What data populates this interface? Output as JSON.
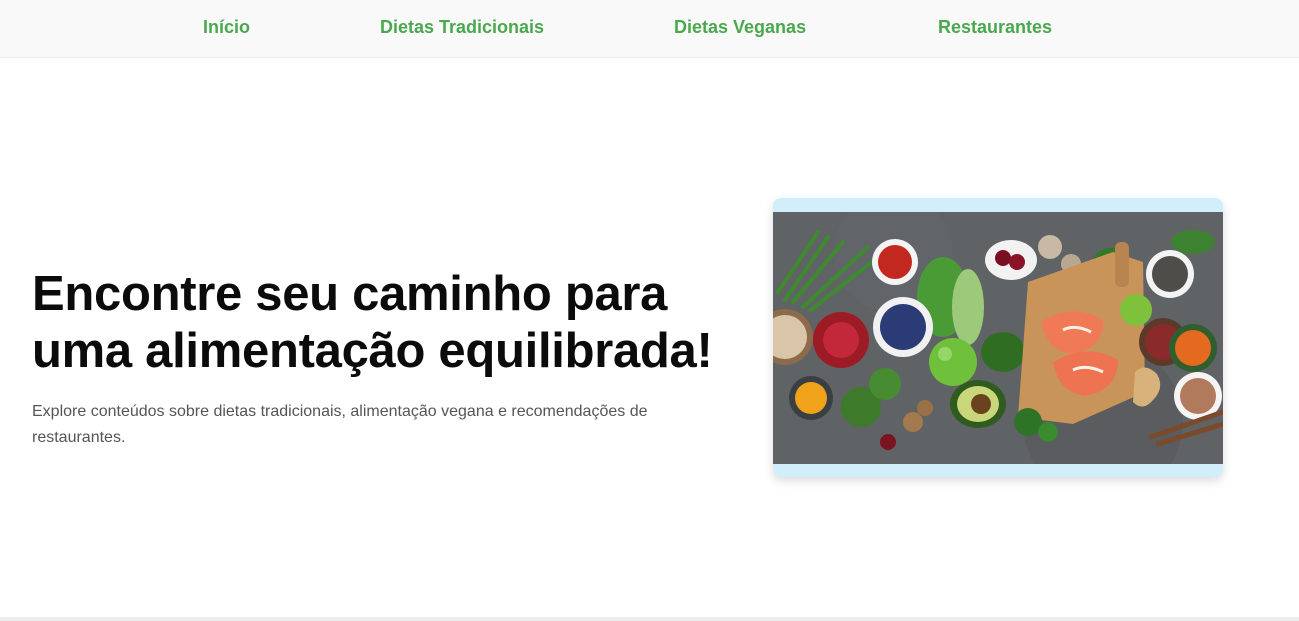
{
  "nav": {
    "items": [
      {
        "label": "Início"
      },
      {
        "label": "Dietas Tradicionais"
      },
      {
        "label": "Dietas Veganas"
      },
      {
        "label": "Restaurantes"
      }
    ]
  },
  "hero": {
    "title": "Encontre seu caminho para uma alimentação equilibrada!",
    "description": "Explore conteúdos sobre dietas tradicionais, alimentação vegana e recomendações de restaurantes."
  },
  "colors": {
    "nav_link": "#4aa84f",
    "nav_background": "#f9f9f9",
    "card_frame": "#d3eefb",
    "title_text": "#0b0b0b",
    "body_text": "#555555"
  }
}
